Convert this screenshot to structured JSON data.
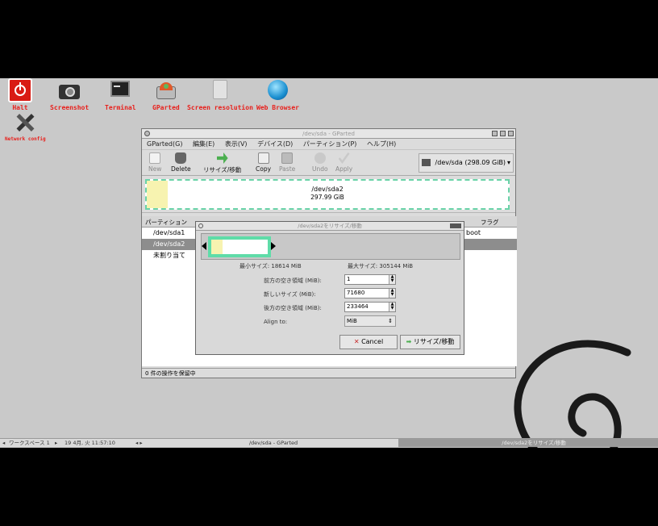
{
  "desktop": {
    "icons": [
      {
        "label": "Halt",
        "icon": "power-icon"
      },
      {
        "label": "Screenshot",
        "icon": "camera-icon"
      },
      {
        "label": "Terminal",
        "icon": "terminal-icon"
      },
      {
        "label": "GParted",
        "icon": "disk-icon"
      },
      {
        "label": "Screen resolution",
        "icon": "monitor-icon"
      },
      {
        "label": "Web Browser",
        "icon": "globe-icon"
      },
      {
        "label": "Network config",
        "icon": "tools-icon"
      }
    ]
  },
  "gparted": {
    "title": "/dev/sda - GParted",
    "menu": [
      "GParted(G)",
      "編集(E)",
      "表示(V)",
      "デバイス(D)",
      "パーティション(P)",
      "ヘルプ(H)"
    ],
    "toolbar": {
      "new": "New",
      "delete": "Delete",
      "resize": "リサイズ/移動",
      "copy": "Copy",
      "paste": "Paste",
      "undo": "Undo",
      "apply": "Apply"
    },
    "device": "/dev/sda  (298.09 GiB)",
    "graph": {
      "name": "/dev/sda2",
      "size": "297.99 GiB"
    },
    "columns": {
      "partition": "パーティション",
      "flags": "フラグ"
    },
    "rows": [
      {
        "partition": "/dev/sda1",
        "flags": "boot"
      },
      {
        "partition": "/dev/sda2",
        "flags": ""
      },
      {
        "partition": "未割り当て",
        "flags": ""
      }
    ],
    "status": "0 件の操作を保留中"
  },
  "dialog": {
    "title": "/dev/sda2をリサイズ/移動",
    "min_label": "最小サイズ: 18614 MiB",
    "max_label": "最大サイズ: 305144 MiB",
    "free_before_label": "前方の空き領域 (MiB):",
    "free_before_value": "1",
    "new_size_label": "新しいサイズ (MiB):",
    "new_size_value": "71680",
    "free_after_label": "後方の空き領域 (MiB):",
    "free_after_value": "233464",
    "align_label": "Align to:",
    "align_value": "MiB",
    "cancel": "Cancel",
    "resize": "リサイズ/移動"
  },
  "panel": {
    "workspace": "ワークスペース 1",
    "clock": "19 4月, 火 11:57:10",
    "task1": "/dev/sda - GParted",
    "task2": "/dev/sda2をリサイズ/移動"
  },
  "colors": {
    "accent_green": "#5fdca8",
    "used_yellow": "#f7f3b0",
    "icon_text": "#e8201c"
  }
}
